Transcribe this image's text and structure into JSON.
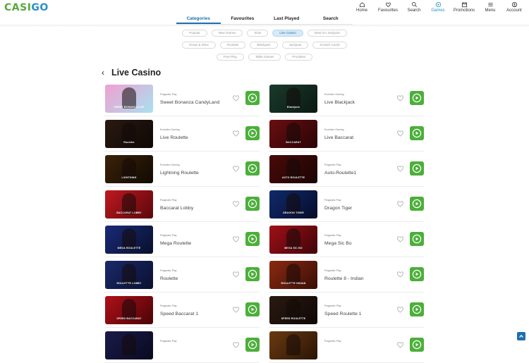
{
  "brand": {
    "logo_prefix": "CASI",
    "logo_suffix": "GO"
  },
  "nav": [
    {
      "label": "Home",
      "icon": "home-icon"
    },
    {
      "label": "Favourites",
      "icon": "heart-icon"
    },
    {
      "label": "Search",
      "icon": "search-icon"
    },
    {
      "label": "Games",
      "icon": "games-icon",
      "active": true
    },
    {
      "label": "Promotions",
      "icon": "calendar-icon"
    },
    {
      "label": "Menu",
      "icon": "menu-icon"
    },
    {
      "label": "Account",
      "icon": "account-icon"
    }
  ],
  "tabs": [
    {
      "label": "Categories",
      "active": true
    },
    {
      "label": "Favourites"
    },
    {
      "label": "Last Played"
    },
    {
      "label": "Search"
    }
  ],
  "categories": [
    [
      "Popular",
      "New Games",
      "Slots",
      "Live Casino",
      "Must Go Jackpots"
    ],
    [
      "Drops & Wins",
      "Roulette",
      "Blackjack",
      "Jackpots",
      "Scratch Cards"
    ],
    [
      "Free Play",
      "Table Games",
      "Providers"
    ]
  ],
  "selected_category": "Live Casino",
  "page_title": "Live Casino",
  "games": [
    {
      "name": "Sweet Bonanza CandyLand",
      "provider": "Pragmatic Play",
      "thumb_label": "SWEET BONANZA LIVE",
      "colors": [
        "#f0a0d0",
        "#a8e0f0"
      ]
    },
    {
      "name": "Live Blackjack",
      "provider": "Evolution Gaming",
      "thumb_label": "Blackjack",
      "colors": [
        "#1a3a2a",
        "#0a1a14"
      ]
    },
    {
      "name": "Live Roulette",
      "provider": "Evolution Gaming",
      "thumb_label": "Roulette",
      "colors": [
        "#2a1a10",
        "#0e0806"
      ]
    },
    {
      "name": "Live Baccarat",
      "provider": "Evolution Gaming",
      "thumb_label": "BACCARAT",
      "colors": [
        "#6a0e10",
        "#2a0406"
      ]
    },
    {
      "name": "Lightning Roulette",
      "provider": "Evolution Gaming",
      "thumb_label": "LIGHTNING",
      "colors": [
        "#3a2208",
        "#120a02"
      ]
    },
    {
      "name": "Auto-Roulette1",
      "provider": "Pragmatic Play",
      "thumb_label": "AUTO ROULETTE",
      "colors": [
        "#4a0a08",
        "#1a0404"
      ]
    },
    {
      "name": "Baccarat Lobby",
      "provider": "Pragmatic Play",
      "thumb_label": "BACCARAT LOBBY",
      "colors": [
        "#c01820",
        "#5a080c"
      ]
    },
    {
      "name": "Dragon Tiger",
      "provider": "Pragmatic Play",
      "thumb_label": "DRAGON TIGER",
      "colors": [
        "#102a6a",
        "#060c2a"
      ]
    },
    {
      "name": "Mega Roulette",
      "provider": "Pragmatic Play",
      "thumb_label": "MEGA ROULETTE",
      "colors": [
        "#1a2a7a",
        "#08102a"
      ]
    },
    {
      "name": "Mega Sic Bo",
      "provider": "Pragmatic Play",
      "thumb_label": "MEGA SIC BO",
      "colors": [
        "#a01018",
        "#400408"
      ]
    },
    {
      "name": "Roulette",
      "provider": "Pragmatic Play",
      "thumb_label": "ROULETTE LOBBY",
      "colors": [
        "#1a2a6a",
        "#0a1030"
      ]
    },
    {
      "name": "Roulette 8 - Indian",
      "provider": "Pragmatic Play",
      "thumb_label": "ROULETTE INDIAN",
      "colors": [
        "#8a2a10",
        "#3a0e06"
      ]
    },
    {
      "name": "Speed Baccarat 1",
      "provider": "Pragmatic Play",
      "thumb_label": "SPEED BACCARAT",
      "colors": [
        "#b01018",
        "#4a0408"
      ]
    },
    {
      "name": "Speed Roulette 1",
      "provider": "Pragmatic Play",
      "thumb_label": "SPEED ROULETTE",
      "colors": [
        "#2a1a10",
        "#100806"
      ]
    },
    {
      "name": "",
      "provider": "Pragmatic Play",
      "thumb_label": "",
      "colors": [
        "#1a1a4a",
        "#0a0a20"
      ]
    },
    {
      "name": "",
      "provider": "Pragmatic Play",
      "thumb_label": "",
      "colors": [
        "#6a3a10",
        "#2a1406"
      ]
    }
  ],
  "colors": {
    "accent": "#1e6fb0",
    "play": "#4caf3a",
    "brand_green": "#5aa83a"
  }
}
